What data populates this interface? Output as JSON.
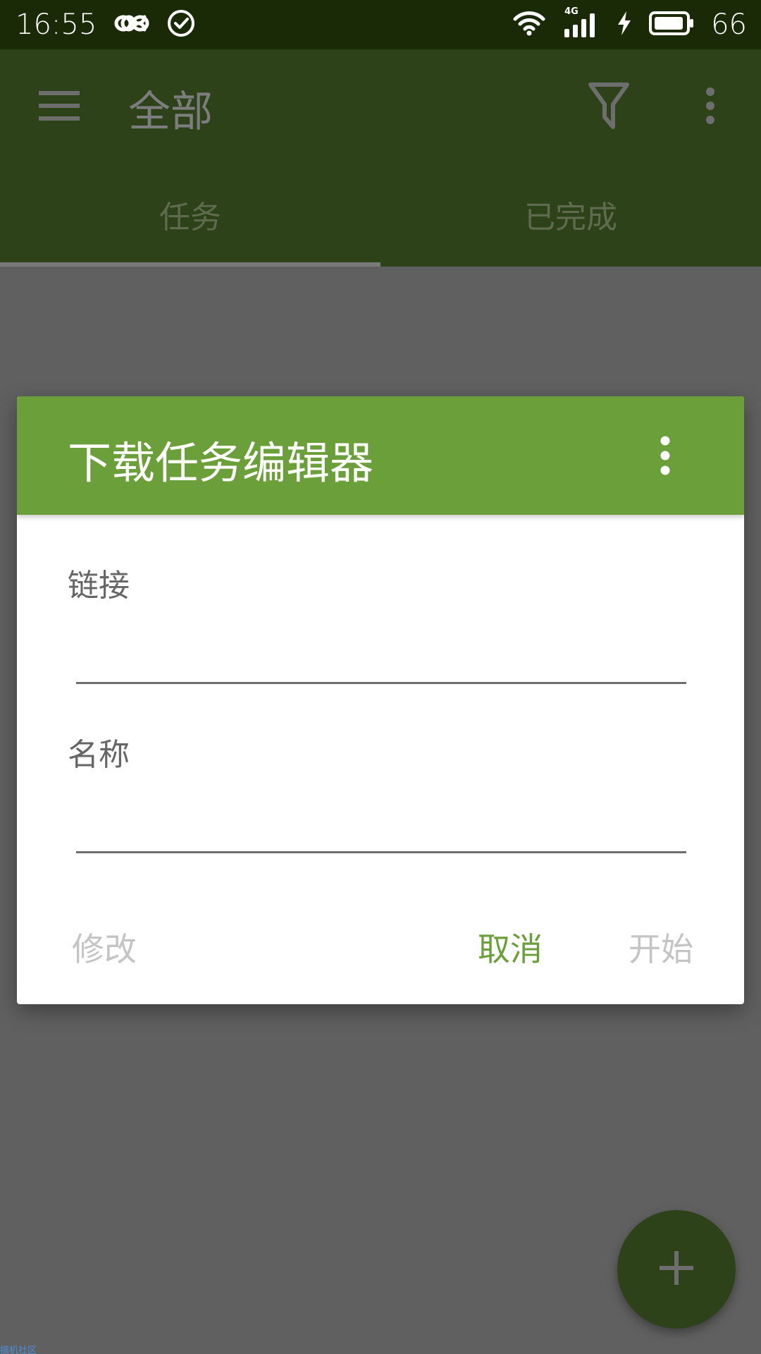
{
  "status_bar": {
    "time": "16:55",
    "network_label": "4G",
    "battery_level": "66",
    "icons": [
      "infinity-icon",
      "check-circle-icon",
      "wifi-icon",
      "signal-icon",
      "charging-icon",
      "battery-icon"
    ]
  },
  "app_bar": {
    "title": "全部",
    "icons": [
      "menu-icon",
      "filter-icon",
      "more-vert-icon"
    ],
    "tabs": [
      {
        "label": "任务",
        "selected": true
      },
      {
        "label": "已完成",
        "selected": false
      }
    ]
  },
  "dialog": {
    "title": "下载任务编辑器",
    "fields": [
      {
        "label": "链接",
        "value": "",
        "placeholder": ""
      },
      {
        "label": "名称",
        "value": "",
        "placeholder": ""
      }
    ],
    "buttons": {
      "modify": "修改",
      "cancel": "取消",
      "start": "开始"
    }
  },
  "fab": {
    "icon": "plus-icon"
  },
  "watermark": "搞机社区",
  "colors": {
    "status_bar": "#1a2a06",
    "app_bar_dimmed": "#2e4219",
    "dialog_header": "#6b9f3a",
    "accent": "#6b9f3a",
    "scrim": "#606060"
  }
}
